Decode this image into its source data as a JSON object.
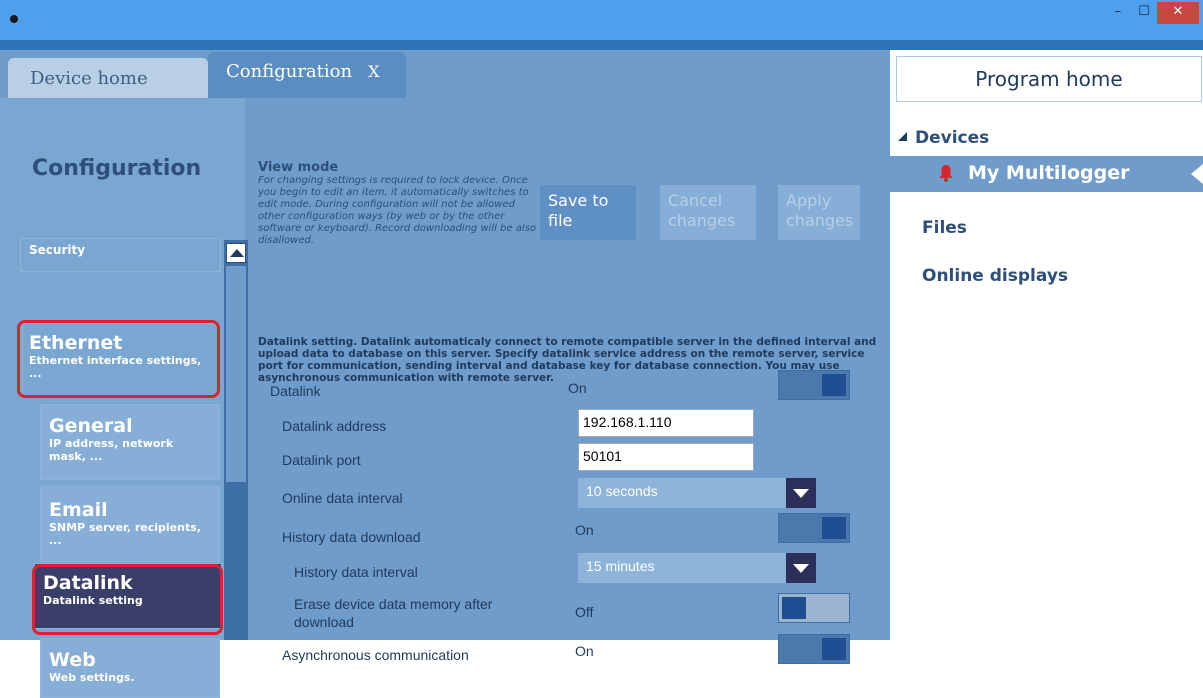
{
  "window": {
    "min": "–",
    "max": "☐",
    "close": "✕"
  },
  "tabs": {
    "home": "Device home",
    "config": "Configuration",
    "config_close": "X"
  },
  "left": {
    "title": "Configuration",
    "items": {
      "security": "Security",
      "ethernet": {
        "title": "Ethernet",
        "sub": "Ethernet interface settings, ..."
      },
      "general": {
        "title": "General",
        "sub": "IP address, network mask, ..."
      },
      "email": {
        "title": "Email",
        "sub": "SNMP server, recipients, ..."
      },
      "datalink": {
        "title": "Datalink",
        "sub": "Datalink setting"
      },
      "web": {
        "title": "Web",
        "sub": "Web settings."
      }
    }
  },
  "view_mode": {
    "title": "View mode",
    "text": "For changing settings is required to lock device. Once you begin to edit an item, it automatically switches to edit mode. During configuration will not be allowed other configuration ways (by web or by the other software or keyboard). Record downloading will be also disallowed."
  },
  "actions": {
    "save": "Save to file",
    "cancel": "Cancel changes",
    "apply": "Apply changes"
  },
  "description": "Datalink setting. Datalink automaticaly connect to remote compatible server in the defined interval and upload data to database on this server. Specify datalink service address on the remote server, service port for communication, sending interval and database key for database connection. You may use asynchronous communication with remote server.",
  "settings": {
    "datalink": {
      "label": "Datalink",
      "value": "On"
    },
    "address": {
      "label": "Datalink address",
      "value": "192.168.1.110"
    },
    "port": {
      "label": "Datalink port",
      "value": "50101"
    },
    "online_interval": {
      "label": "Online data interval",
      "value": "10 seconds"
    },
    "history_download": {
      "label": "History data download",
      "value": "On"
    },
    "history_interval": {
      "label": "History data interval",
      "value": "15 minutes"
    },
    "erase": {
      "label": "Erase device data memory after download",
      "value": "Off"
    },
    "async": {
      "label": "Asynchronous communication",
      "value": "On"
    }
  },
  "right": {
    "program_home": "Program home",
    "devices": "Devices",
    "device_name": "My Multilogger",
    "files": "Files",
    "online_displays": "Online displays"
  },
  "colors": {
    "accent": "#6f9ccb",
    "selected": "#3a3f6a",
    "highlight": "#d9232d",
    "bell": "#d9232d"
  }
}
